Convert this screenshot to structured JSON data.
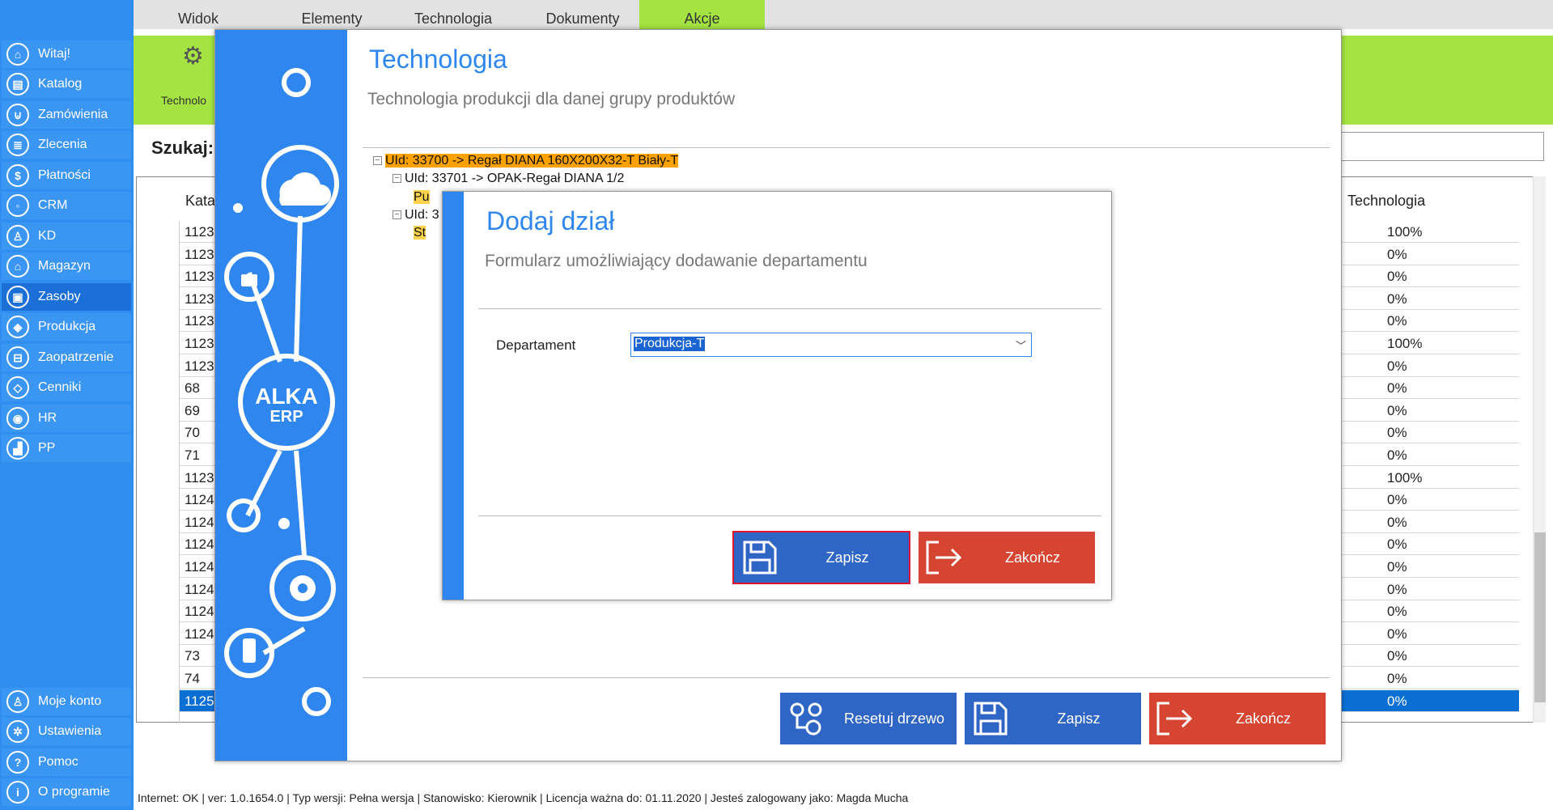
{
  "sidebar": {
    "items": [
      {
        "label": "Witaj!",
        "icon": "home-icon",
        "glyph": "⌂"
      },
      {
        "label": "Katalog",
        "icon": "book-icon",
        "glyph": "▤"
      },
      {
        "label": "Zamówienia",
        "icon": "cart-icon",
        "glyph": "⊍"
      },
      {
        "label": "Zlecenia",
        "icon": "list-icon",
        "glyph": "≣"
      },
      {
        "label": "Płatności",
        "icon": "dollar-icon",
        "glyph": "$"
      },
      {
        "label": "CRM",
        "icon": "crm-icon",
        "glyph": "◦"
      },
      {
        "label": "KD",
        "icon": "person-icon",
        "glyph": "♙"
      },
      {
        "label": "Magazyn",
        "icon": "warehouse-icon",
        "glyph": "⌂"
      },
      {
        "label": "Zasoby",
        "icon": "resources-icon",
        "glyph": "▣"
      },
      {
        "label": "Produkcja",
        "icon": "production-icon",
        "glyph": "◈"
      },
      {
        "label": "Zaopatrzenie",
        "icon": "truck-icon",
        "glyph": "⊟"
      },
      {
        "label": "Cenniki",
        "icon": "tag-icon",
        "glyph": "◇"
      },
      {
        "label": "HR",
        "icon": "hr-icon",
        "glyph": "◉"
      },
      {
        "label": "PP",
        "icon": "factory-icon",
        "glyph": "▟"
      }
    ],
    "bottom": [
      {
        "label": "Moje konto",
        "icon": "account-icon",
        "glyph": "♙"
      },
      {
        "label": "Ustawienia",
        "icon": "settings-icon",
        "glyph": "✲"
      },
      {
        "label": "Pomoc",
        "icon": "help-icon",
        "glyph": "?"
      },
      {
        "label": "O programie",
        "icon": "info-icon",
        "glyph": "i"
      }
    ]
  },
  "menu": {
    "tabs": [
      "Widok",
      "Elementy",
      "Technologia",
      "Dokumenty",
      "Akcje"
    ]
  },
  "ribbon": {
    "label": "Technolo"
  },
  "search": {
    "label": "Szukaj:"
  },
  "grid": {
    "col_catalog": "Kata",
    "col_technology": "Technologia",
    "rows": [
      [
        "1123",
        "100%"
      ],
      [
        "1123",
        "0%"
      ],
      [
        "1123",
        "0%"
      ],
      [
        "1123",
        "0%"
      ],
      [
        "1123",
        "0%"
      ],
      [
        "1123",
        "100%"
      ],
      [
        "1123",
        "0%"
      ],
      [
        "68",
        "0%"
      ],
      [
        "69",
        "0%"
      ],
      [
        "70",
        "0%"
      ],
      [
        "71",
        "0%"
      ],
      [
        "1123",
        "100%"
      ],
      [
        "1124",
        "0%"
      ],
      [
        "1124",
        "0%"
      ],
      [
        "1124",
        "0%"
      ],
      [
        "1124",
        "0%"
      ],
      [
        "1124",
        "0%"
      ],
      [
        "1124",
        "0%"
      ],
      [
        "1124",
        "0%"
      ],
      [
        "73",
        "0%"
      ],
      [
        "74",
        "0%"
      ],
      [
        "1125",
        "0%"
      ]
    ]
  },
  "statusbar": {
    "text": "Internet: OK  |   ver: 1.0.1654.0   |   Typ wersji: Pełna wersja   |   Stanowisko: Kierownik   |   Licencja ważna do: 01.11.2020   |   Jesteś zalogowany jako: Magda Mucha"
  },
  "tech": {
    "title": "Technologia",
    "subtitle": "Technologia produkcji dla danej grupy produktów",
    "brand": "ALKA",
    "brand_sub": "ERP",
    "tree": {
      "root": "UId: 33700 -> Regał DIANA 160X200X32-T Biały-T",
      "child1": "UId: 33701 -> OPAK-Regał DIANA   1/2",
      "child1_leaf": "Pu",
      "child2": "UId: 3",
      "child2_leaf": "St"
    },
    "reset_label": "Resetuj drzewo",
    "save_label": "Zapisz",
    "close_label": "Zakończ"
  },
  "dialog": {
    "title": "Dodaj dział",
    "subtitle": "Formularz umożliwiający dodawanie departamentu",
    "field_label": "Departament",
    "field_value": "Produkcja-T",
    "save_label": "Zapisz",
    "close_label": "Zakończ"
  },
  "colors": {
    "accent_blue": "#2e86ee",
    "ribbon_green": "#a4e342",
    "danger_red": "#d64531",
    "save_blue": "#2f66c6"
  }
}
